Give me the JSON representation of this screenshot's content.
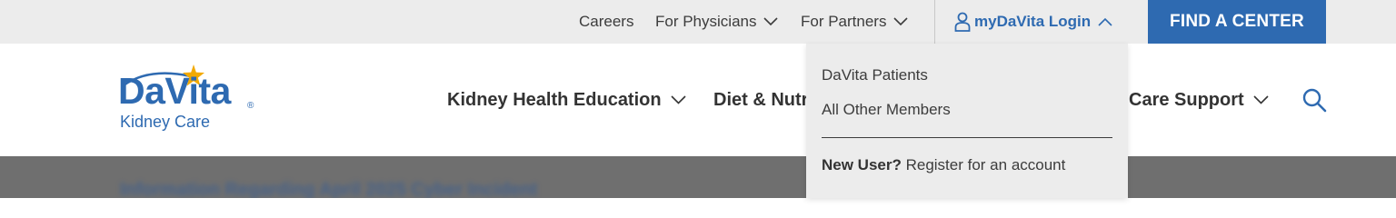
{
  "utility_bar": {
    "careers": "Careers",
    "for_physicians": "For Physicians",
    "for_partners": "For Partners",
    "login": "myDaVita Login",
    "find_center": "FIND A CENTER"
  },
  "logo": {
    "brand": "DaVita",
    "registered": "®",
    "subtitle": "Kidney Care"
  },
  "nav": {
    "kidney_health": "Kidney Health Education",
    "diet": "Diet & Nutr",
    "care_support": "Care Support"
  },
  "login_dropdown": {
    "patients": "DaVita Patients",
    "other_members": "All Other Members",
    "new_user_bold": "New User?",
    "new_user_rest": " Register for an account"
  },
  "hero": {
    "blurred_text": "Information Regarding April 2025 Cyber Incident"
  },
  "colors": {
    "brand_blue": "#2e6ab1",
    "star": "#f2a900",
    "utility_bg": "#ececec"
  },
  "icons": [
    "chevron-down-icon",
    "chevron-up-icon",
    "person-icon",
    "search-icon",
    "star-icon"
  ]
}
